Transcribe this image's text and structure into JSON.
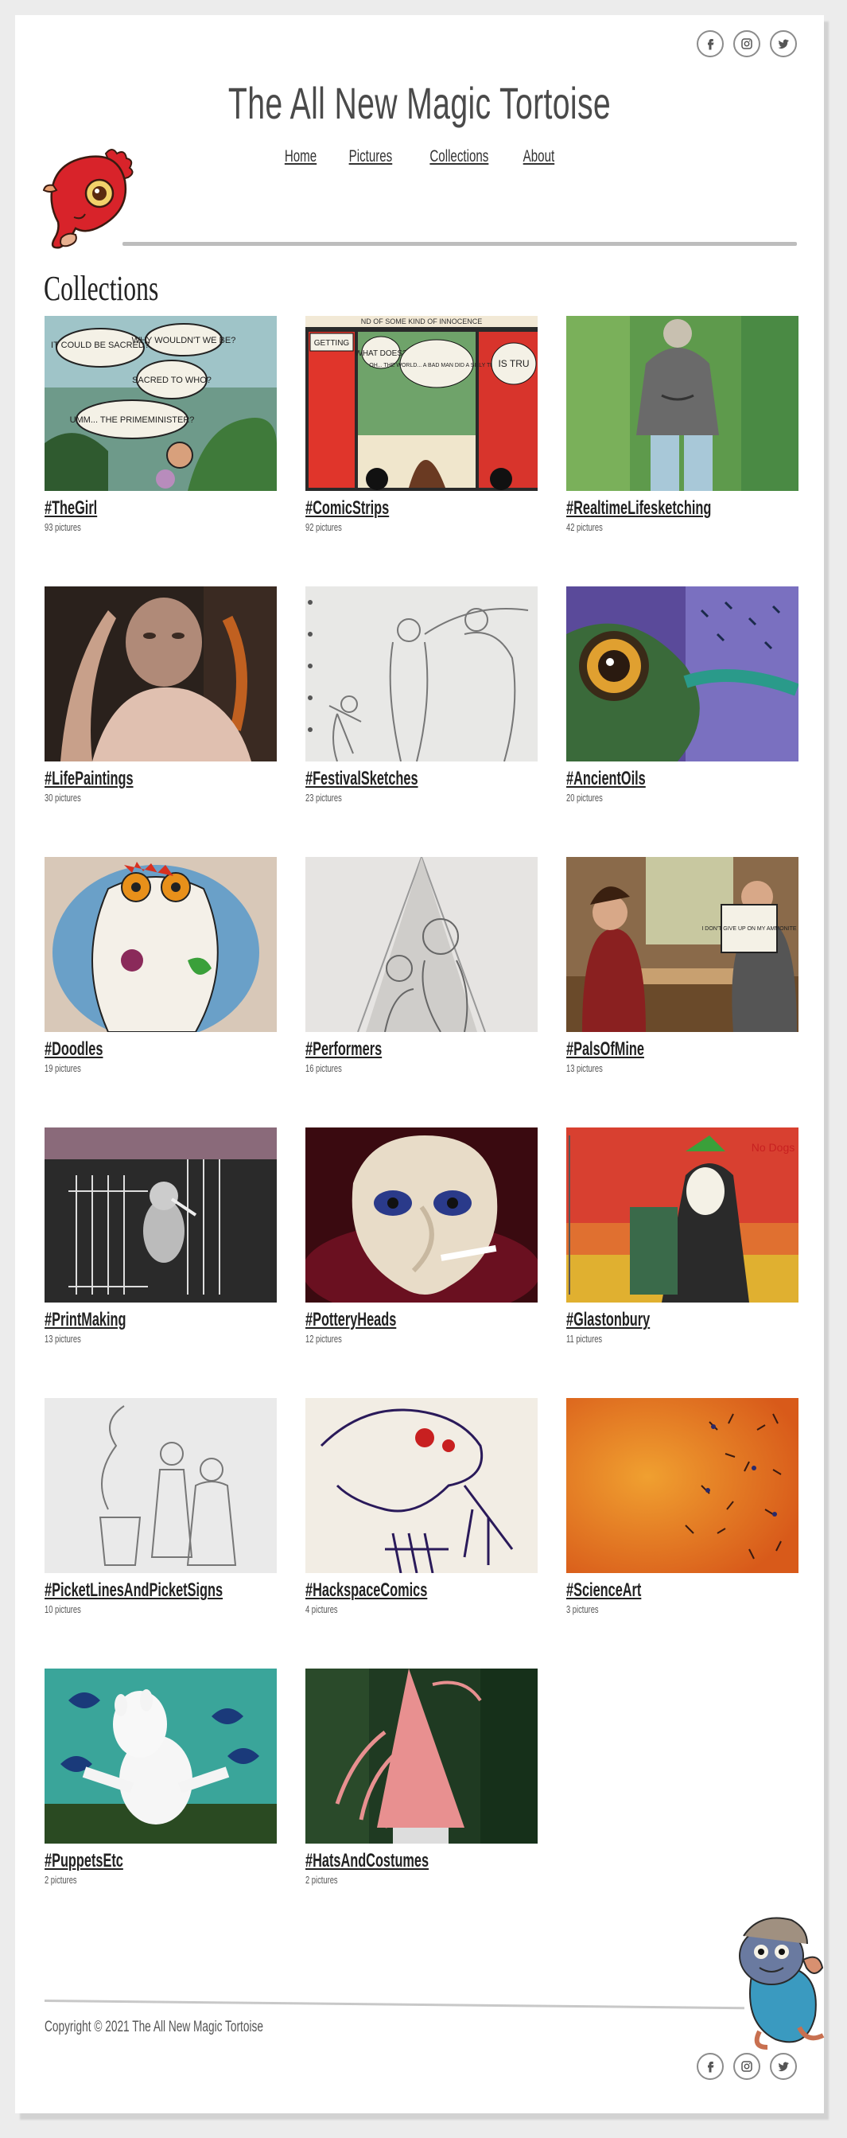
{
  "site": {
    "title": "The All New Magic Tortoise",
    "nav": [
      "Home",
      "Pictures",
      "Collections",
      "About"
    ],
    "social_icons": [
      "facebook-icon",
      "instagram-icon",
      "twitter-icon"
    ]
  },
  "page": {
    "heading": "Collections"
  },
  "collections": [
    {
      "title": "#TheGirl",
      "count": "93 pictures"
    },
    {
      "title": "#ComicStrips",
      "count": "92 pictures"
    },
    {
      "title": "#RealtimeLifesketching",
      "count": "42 pictures"
    },
    {
      "title": "#LifePaintings",
      "count": "30 pictures"
    },
    {
      "title": "#FestivalSketches",
      "count": "23 pictures"
    },
    {
      "title": "#AncientOils",
      "count": "20 pictures"
    },
    {
      "title": "#Doodles",
      "count": "19 pictures"
    },
    {
      "title": "#Performers",
      "count": "16 pictures"
    },
    {
      "title": "#PalsOfMine",
      "count": "13 pictures"
    },
    {
      "title": "#PrintMaking",
      "count": "13 pictures"
    },
    {
      "title": "#PotteryHeads",
      "count": "12 pictures"
    },
    {
      "title": "#Glastonbury",
      "count": "11 pictures"
    },
    {
      "title": "#PicketLinesAndPicketSigns",
      "count": "10 pictures"
    },
    {
      "title": "#HackspaceComics",
      "count": "4 pictures"
    },
    {
      "title": "#ScienceArt",
      "count": "3 pictures"
    },
    {
      "title": "#PuppetsEtc",
      "count": "2 pictures"
    },
    {
      "title": "#HatsAndCostumes",
      "count": "2 pictures"
    }
  ],
  "thumb_text": {
    "girl_1": "IT COULD BE SACRED?",
    "girl_2": "SACRED TO WHO?",
    "girl_3": "WHY WOULDN'T WE BE?",
    "girl_4": "UMM... THE PRIMEMINISTER?",
    "comic_top": "ND OF SOME KIND OF INNOCENCE",
    "comic_1": "GETTING",
    "comic_2": "WHAT DOES?",
    "comic_3": "OH... THE WORLD... A BAD MAN DID A SILLY THING",
    "comic_4": "IS TRU",
    "pals_sign": "I DON'T GIVE UP ON MY AMMONITE",
    "glasto_sign": "No Dogs"
  },
  "footer": {
    "copyright": "Copyright © 2021 The All New Magic Tortoise"
  },
  "colors": {
    "text": "#222222",
    "rule": "#bdbdbd",
    "background": "#ececec",
    "page": "#ffffff"
  }
}
